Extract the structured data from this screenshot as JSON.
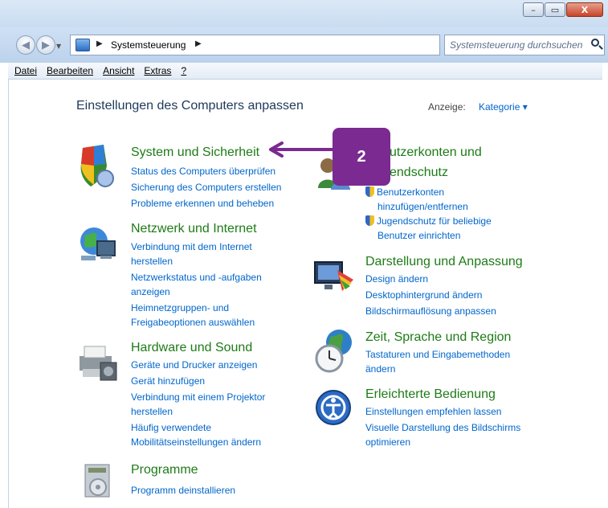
{
  "window": {
    "min": "–",
    "max": "▭",
    "close": "X"
  },
  "address": {
    "crumb": "Systemsteuerung",
    "search_placeholder": "Systemsteuerung durchsuchen"
  },
  "menu": {
    "items": [
      "Datei",
      "Bearbeiten",
      "Ansicht",
      "Extras",
      "?"
    ]
  },
  "header": {
    "title": "Einstellungen des Computers anpassen",
    "view_label": "Anzeige:",
    "view_value": "Kategorie ▾"
  },
  "categories": {
    "system": {
      "title": "System und Sicherheit",
      "links": [
        "Status des Computers überprüfen",
        "Sicherung des Computers erstellen",
        "Probleme erkennen und beheben"
      ]
    },
    "network": {
      "title": "Netzwerk und Internet",
      "links": [
        "Verbindung mit dem Internet",
        "herstellen",
        "Netzwerkstatus und -aufgaben",
        "anzeigen",
        "Heimnetzgruppen- und",
        "Freigabeoptionen auswählen"
      ]
    },
    "hardware": {
      "title": "Hardware und Sound",
      "links": [
        "Geräte und Drucker anzeigen",
        "Gerät hinzufügen",
        "Verbindung mit einem Projektor",
        "herstellen",
        "Häufig verwendete",
        "Mobilitätseinstellungen ändern"
      ]
    },
    "programs": {
      "title": "Programme",
      "links": [
        "Programm deinstallieren"
      ]
    },
    "users": {
      "title_line1": "utzerkonten und",
      "title_line2": "endschutz",
      "links": [
        "Benutzerkonten",
        "hinzufügen/entfernen",
        "Jugendschutz für beliebige",
        "Benutzer einrichten"
      ]
    },
    "appearance": {
      "title": "Darstellung und Anpassung",
      "links": [
        "Design ändern",
        "Desktophintergrund ändern",
        "Bildschirmauflösung anpassen"
      ]
    },
    "clock": {
      "title": "Zeit, Sprache und Region",
      "links": [
        "Tastaturen und Eingabemethoden",
        "ändern"
      ]
    },
    "ease": {
      "title": "Erleichterte Bedienung",
      "links": [
        "Einstellungen empfehlen lassen",
        "Visuelle Darstellung des Bildschirms",
        "optimieren"
      ]
    }
  },
  "annotation": {
    "number": "2",
    "color": "#7b2a91"
  }
}
